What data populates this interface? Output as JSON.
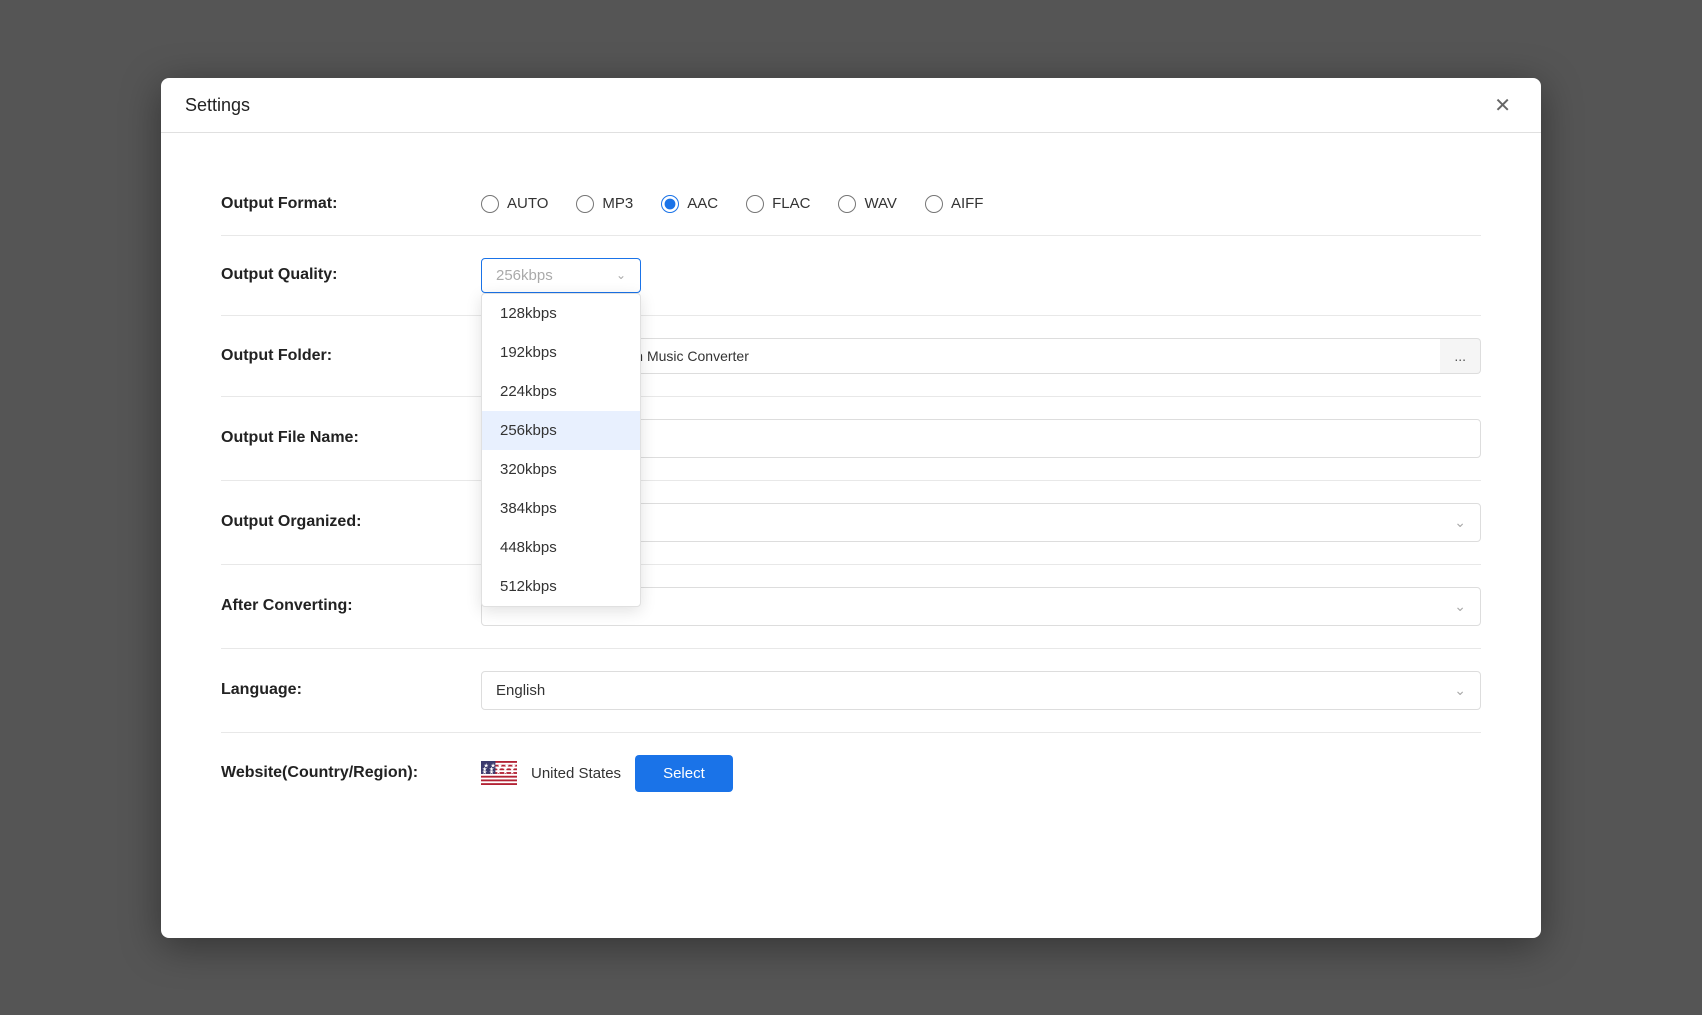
{
  "window": {
    "title": "Settings",
    "close_label": "✕"
  },
  "output_format": {
    "label": "Output Format:",
    "options": [
      "AUTO",
      "MP3",
      "AAC",
      "FLAC",
      "WAV",
      "AIFF"
    ],
    "selected": "AAC"
  },
  "output_quality": {
    "label": "Output Quality:",
    "selected": "256kbps",
    "placeholder": "256kbps",
    "options": [
      "128kbps",
      "192kbps",
      "224kbps",
      "256kbps",
      "320kbps",
      "384kbps",
      "448kbps",
      "512kbps"
    ]
  },
  "output_folder": {
    "label": "Output Folder:",
    "path": "nents\\Ukeysoft Amazon Music Converter",
    "browse_label": "..."
  },
  "output_file_name": {
    "label": "Output File Name:",
    "value": ""
  },
  "output_organized": {
    "label": "Output Organized:",
    "value": ""
  },
  "after_converting": {
    "label": "After Converting:",
    "value": ""
  },
  "language": {
    "label": "Language:",
    "value": "English"
  },
  "website": {
    "label": "Website(Country/Region):",
    "country": "United States",
    "select_label": "Select"
  }
}
